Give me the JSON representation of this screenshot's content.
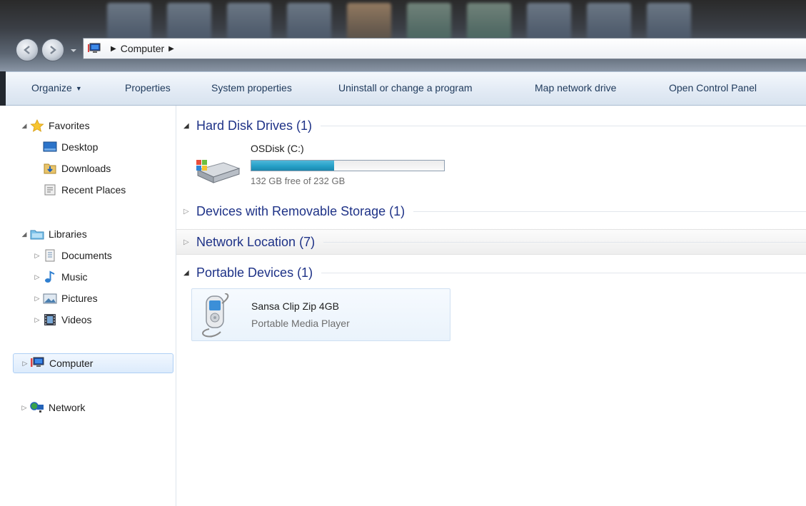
{
  "address_bar": {
    "location": "Computer"
  },
  "toolbar": {
    "organize_label": "Organize",
    "properties_label": "Properties",
    "system_properties_label": "System properties",
    "uninstall_label": "Uninstall or change a program",
    "map_drive_label": "Map network drive",
    "control_panel_label": "Open Control Panel"
  },
  "nav": {
    "favorites": {
      "label": "Favorites",
      "items": [
        "Desktop",
        "Downloads",
        "Recent Places"
      ]
    },
    "libraries": {
      "label": "Libraries",
      "items": [
        "Documents",
        "Music",
        "Pictures",
        "Videos"
      ]
    },
    "computer_label": "Computer",
    "network_label": "Network"
  },
  "groups": {
    "hard_disk": "Hard Disk Drives (1)",
    "removable": "Devices with Removable Storage (1)",
    "network_location": "Network Location (7)",
    "portable": "Portable Devices (1)"
  },
  "drive": {
    "name": "OSDisk (C:)",
    "free_text": "132 GB free of 232 GB",
    "used_fraction": 0.431
  },
  "device": {
    "name": "Sansa Clip Zip 4GB",
    "description": "Portable Media Player"
  },
  "colors": {
    "accent": "#1e3287",
    "bar_fill": "#26a0c8",
    "selection": "#dcebfc"
  }
}
